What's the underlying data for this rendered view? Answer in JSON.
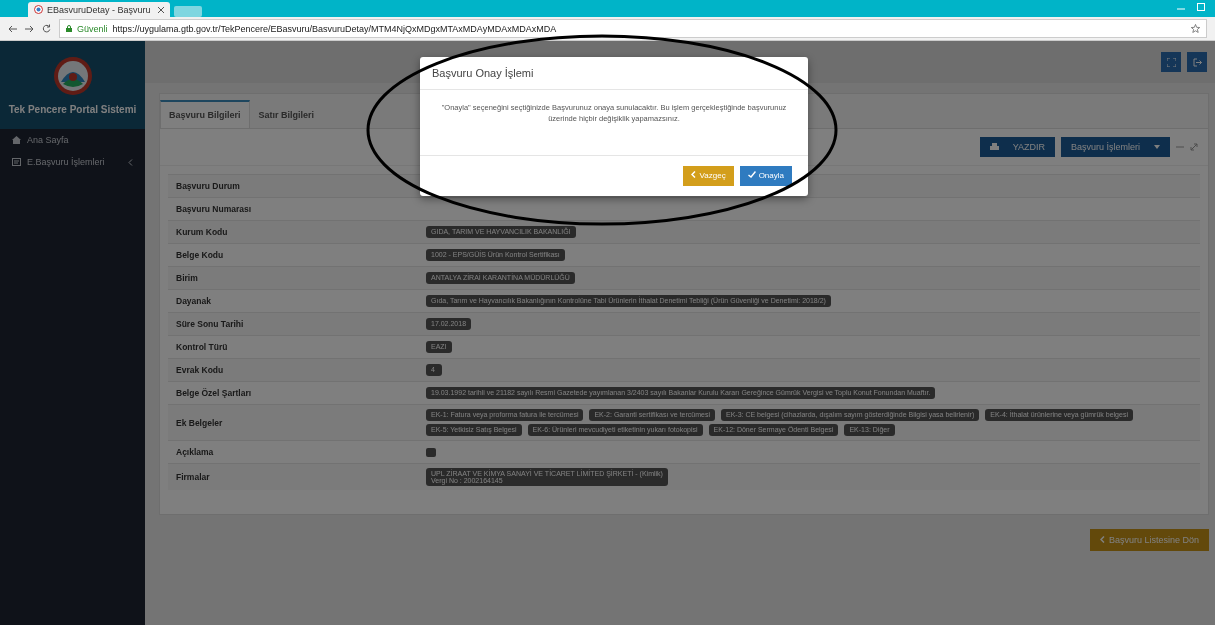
{
  "browser": {
    "tab_title": "EBasvuruDetay - Başvuru",
    "secure_label": "Güvenli",
    "url": "https://uygulama.gtb.gov.tr/TekPencere/EBasvuru/BasvuruDetay/MTM4NjQxMDgxMTAxMDAyMDAxMDAxMDA"
  },
  "sidebar": {
    "title": "Tek Pencere Portal Sistemi",
    "items": [
      {
        "label": "Ana Sayfa",
        "kind": "home",
        "expandable": false
      },
      {
        "label": "E.Başvuru İşlemleri",
        "kind": "form",
        "expandable": true
      }
    ]
  },
  "tabs": [
    {
      "label": "Başvuru Bilgileri",
      "selected": true
    },
    {
      "label": "Satır Bilgileri",
      "selected": false
    }
  ],
  "toolbar": {
    "print_button": "YAZDIR",
    "actions_button": "Başvuru İşlemleri"
  },
  "details": [
    {
      "label": "Başvuru Durum",
      "kind": "none"
    },
    {
      "label": "Başvuru Numarası",
      "kind": "none"
    },
    {
      "label": "Kurum Kodu",
      "values": [
        "GIDA, TARIM VE HAYVANCILIK BAKANLIĞI"
      ]
    },
    {
      "label": "Belge Kodu",
      "values": [
        "1002 - EPS/GÜİS Ürün Kontrol Sertifikası"
      ]
    },
    {
      "label": "Birim",
      "values": [
        "ANTALYA ZİRAİ KARANTİNA MÜDÜRLÜĞÜ"
      ]
    },
    {
      "label": "Dayanak",
      "values": [
        "Gıda, Tarım ve Hayvancılık Bakanlığının Kontrolüne Tabi Ürünlerin İthalat Denetimi Tebliği (Ürün Güvenliği ve Denetimi: 2018/2)"
      ]
    },
    {
      "label": "Süre Sonu Tarihi",
      "values": [
        "17.02.2018"
      ]
    },
    {
      "label": "Kontrol Türü",
      "values": [
        "EAZI"
      ]
    },
    {
      "label": "Evrak Kodu",
      "values": [
        "4"
      ]
    },
    {
      "label": "Belge Özel Şartları",
      "values": [
        "19.03.1992 tarihli ve 21182 sayılı Resmi Gazetede yayımlanan 3/2403 sayılı Bakanlar Kurulu Kararı Gereğince Gümrük Vergisi ve Toplu Konut Fonundan Muaftır."
      ]
    },
    {
      "label": "Ek Belgeler",
      "values": [
        "EK-1: Fatura veya proforma fatura ile tercümesi",
        "EK-2: Garanti sertifikası ve tercümesi",
        "EK-3: CE belgesi (cihazlarda, dışalım sayım gösterdiğinde Bilgisi yasa belirlenir)",
        "EK-4: İthalat ürünlerine veya gümrük belgesi",
        "EK-5: Yetkisiz Satış Belgesi",
        "EK-6: Ürünleri mevcudiyeti etiketinin yukarı fotokopisi",
        "EK-12: Döner Sermaye Ödenti Belgesi",
        "EK-13: Diğer"
      ]
    },
    {
      "label": "Açıklama",
      "kind": "blank"
    },
    {
      "label": "Firmalar",
      "values": [
        "UPL ZİRAAT VE KİMYA SANAYİ VE TİCARET LİMİTED ŞİRKETİ - (Kimlik)\nVergi No : 2002164145"
      ]
    }
  ],
  "back_button": "Başvuru Listesine Dön",
  "modal": {
    "title": "Başvuru Onay İşlemi",
    "message": "\"Onayla\" seçeneğini seçtiğinizde Başvurunuz onaya sunulacaktır. Bu işlem gerçekleştiğinde başvurunuz üzerinde hiçbir değişiklik yapamazsınız.",
    "cancel_button": "Vazgeç",
    "confirm_button": "Onayla"
  }
}
